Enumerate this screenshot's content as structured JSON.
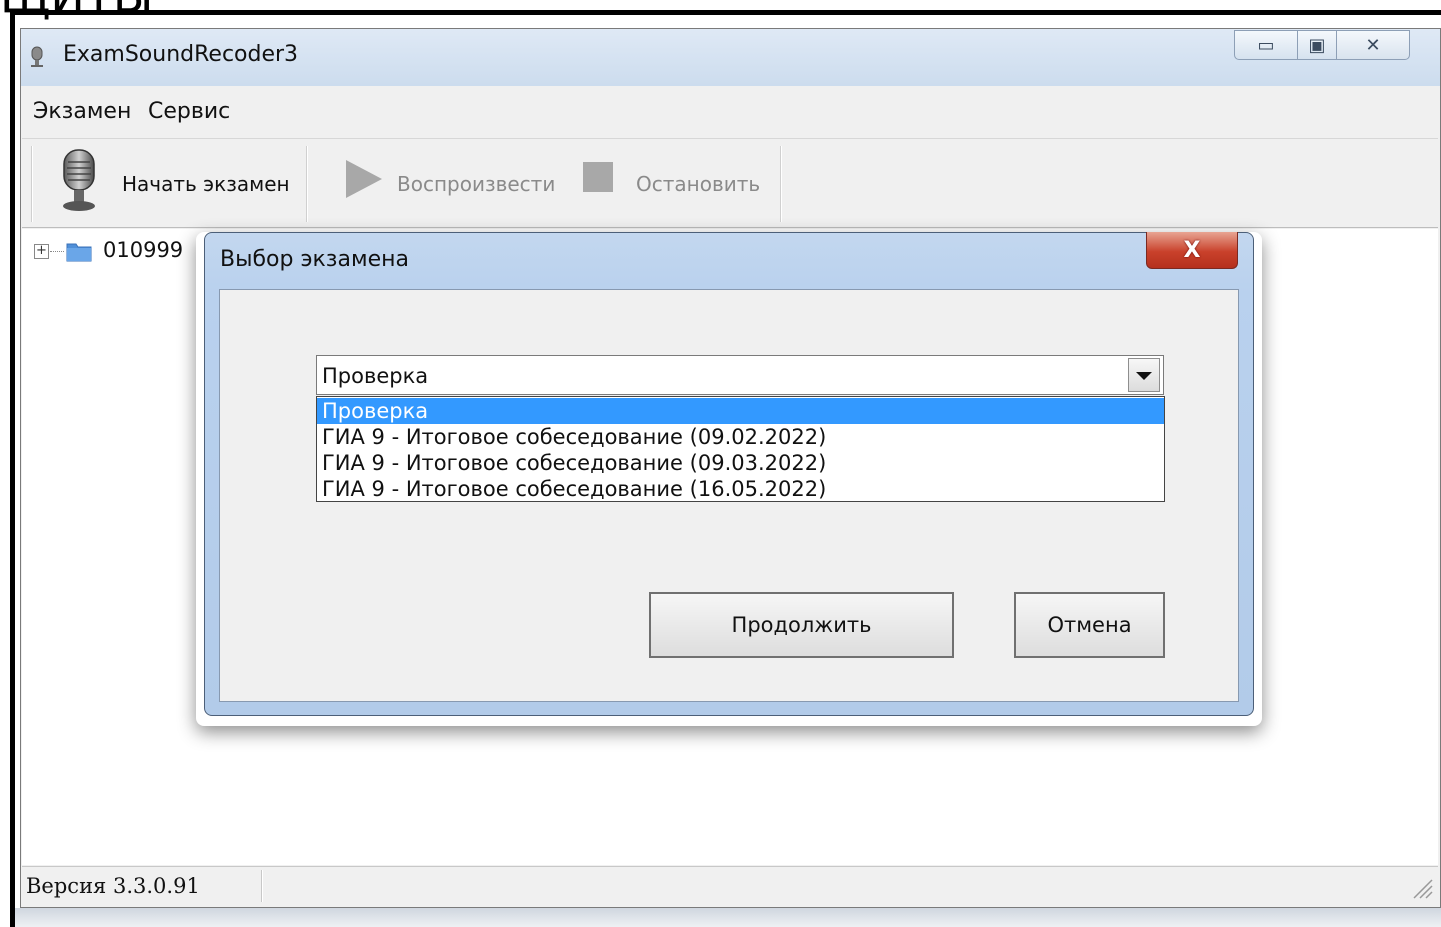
{
  "crop_fragment": "ЩИТЫ",
  "window": {
    "title": "ExamSoundRecoder3",
    "minimize_glyph": "▭",
    "maximize_glyph": "▣",
    "close_glyph": "✕"
  },
  "menu": {
    "items": [
      {
        "label": "Экзамен"
      },
      {
        "label": "Сервис"
      }
    ]
  },
  "toolbar": {
    "start_label": "Начать экзамен",
    "play_label": "Воспроизвести",
    "stop_label": "Остановить"
  },
  "tree": {
    "expander": "+",
    "items": [
      {
        "label": "010999"
      }
    ]
  },
  "statusbar": {
    "version": "Версия 3.3.0.91"
  },
  "dialog": {
    "title": "Выбор экзамена",
    "close_glyph": "X",
    "combo": {
      "selected": "Проверка",
      "options": [
        "Проверка",
        "ГИА 9 - Итоговое собеседование (09.02.2022)",
        "ГИА 9 - Итоговое собеседование (09.03.2022)",
        "ГИА 9 - Итоговое собеседование (16.05.2022)"
      ],
      "highlighted_index": 0
    },
    "continue_label": "Продолжить",
    "cancel_label": "Отмена"
  },
  "colors": {
    "highlight": "#3399ff",
    "close_button": "#c9412b",
    "dialog_frame": "#b9d1ee",
    "disabled_text": "#8a8a8a"
  },
  "icons": {
    "app": "microphone-icon",
    "start": "microphone-icon",
    "play": "play-icon",
    "stop": "stop-icon",
    "tree": "folder-icon"
  }
}
